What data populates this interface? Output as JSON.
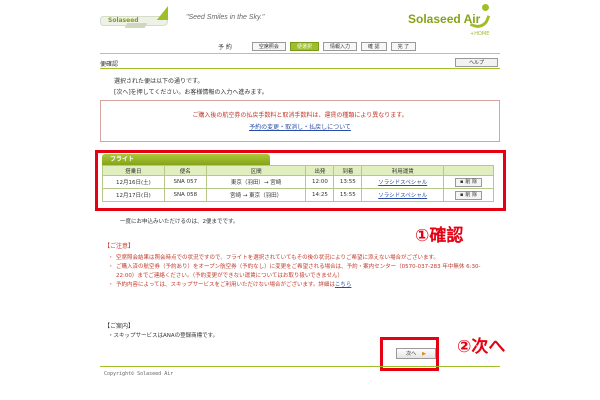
{
  "header": {
    "plane_text": "Solaseed",
    "slogan": "\"Seed Smiles in the Sky.\"",
    "brand": "Solaseed Air",
    "brand_sub": "+HOME"
  },
  "steps": {
    "label": "予  約",
    "items": [
      "空席照会",
      "便選択",
      "情報入力",
      "確  認",
      "完  了"
    ],
    "active_index": 1
  },
  "page": {
    "title": "便確認",
    "help_label": "ヘルプ",
    "intro_lines": [
      "選択された便は以下の通りです。",
      "[次へ]を押してください。お客様情報の入力へ進みます。"
    ]
  },
  "notice": {
    "text": "ご購入後の航空券の払戻手数料と取消手数料は、運賃の種類により異なります。",
    "link": "予約の変更・取消し・払戻しについて"
  },
  "flights": {
    "tab_label": "フライト",
    "headers": [
      "搭乗日",
      "便名",
      "区間",
      "出発",
      "到着",
      "利用運賃",
      ""
    ],
    "rows": [
      {
        "date": "12月16日(土)",
        "flight": "SNA 057",
        "route": "東京（羽田）→ 宮崎",
        "dep": "12:00",
        "arr": "13:55",
        "fare": "ソラシドスペシャル",
        "action": "削 除"
      },
      {
        "date": "12月17日(日)",
        "flight": "SNA 058",
        "route": "宮崎 → 東京（羽田）",
        "dep": "14:25",
        "arr": "15:55",
        "fare": "ソラシドスペシャル",
        "action": "削 除"
      }
    ]
  },
  "once_text": "一度にお申込みいただけるのは、2便までです。",
  "caution": {
    "title": "【ご注意】",
    "items": [
      "空席照会結果は照会時点での状況ですので、フライトを選択されていてもその後の状況によりご希望に添えない場合がございます。",
      "ご購入済の航空券（予約あり）をオープン航空券（予約なし）に変更をご希望される場合は、予約・案内センター（0570-037-283 年中無休 6:30-22:00）までご連絡ください。（予約変更ができない運賃についてはお取り扱いできません）",
      "予約内容によっては、スキップサービスをご利用いただけない場合がございます。詳細は"
    ],
    "link": "こちら"
  },
  "info": {
    "title": "【ご案内】",
    "item": "・スキップサービスはANAの登録商標です。"
  },
  "next_button": "次へ",
  "annotations": {
    "confirm": "①確認",
    "next": "②次へ"
  },
  "copyright": "Copyright© Solaseed Air",
  "colors": {
    "accent_green": "#9fbe2a",
    "annotation_red": "#e60012",
    "caution_red": "#c0392b",
    "link_blue": "#2a4ea8"
  }
}
